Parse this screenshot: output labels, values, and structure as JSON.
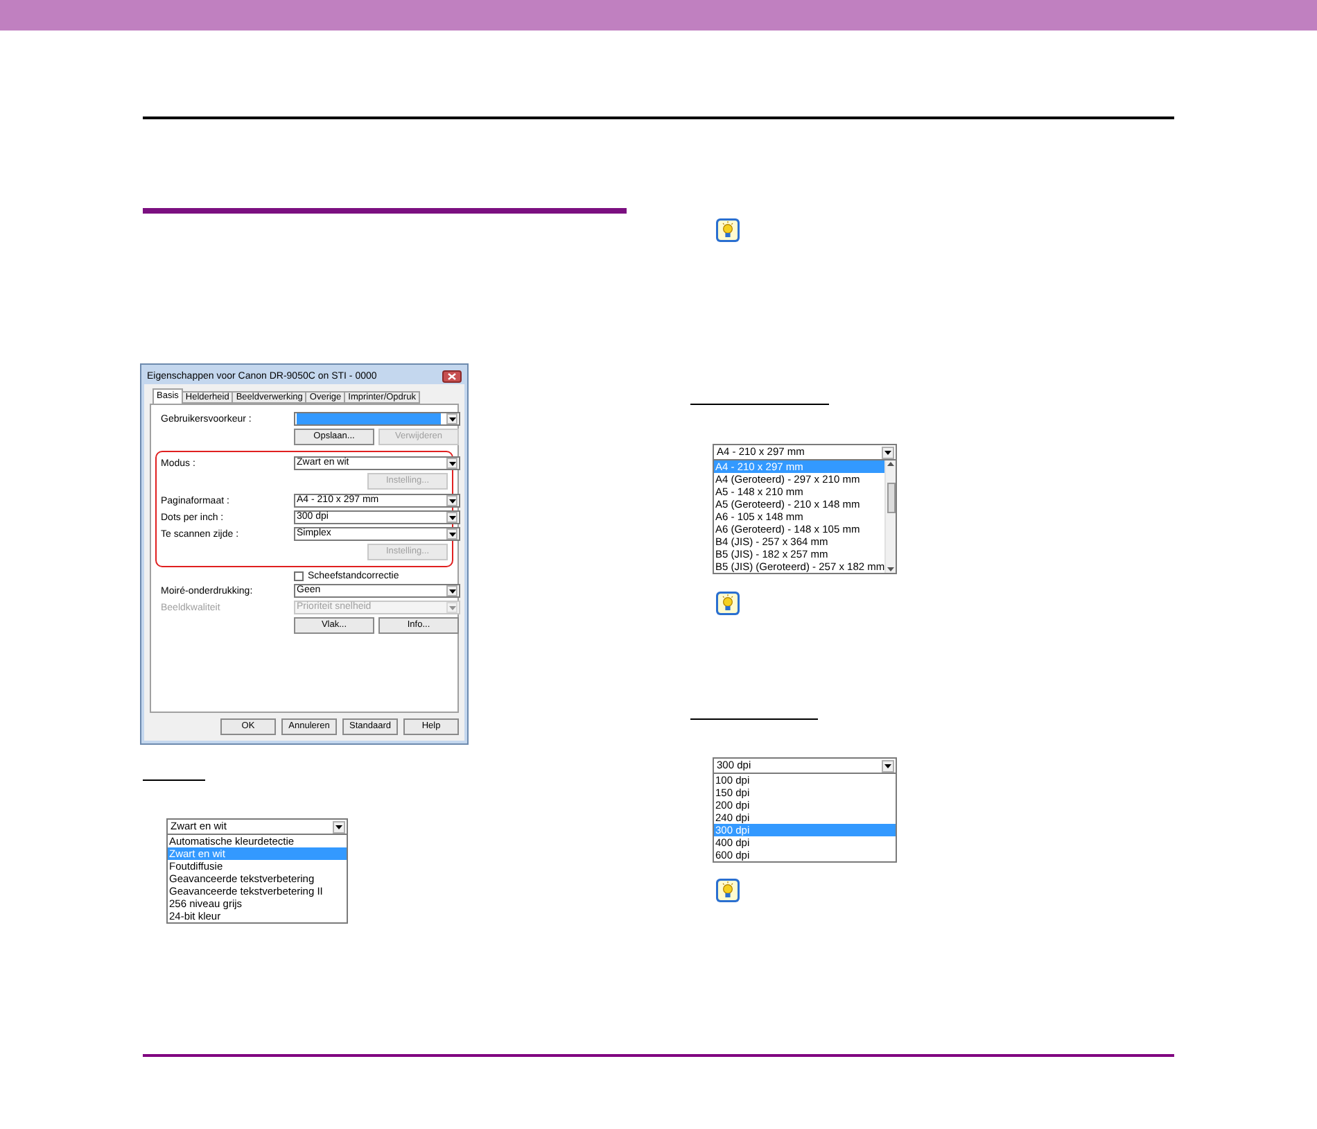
{
  "dialog": {
    "title": "Eigenschappen voor Canon DR-9050C on STI - 0000",
    "tabs": [
      {
        "label": "Basis",
        "selected": true
      },
      {
        "label": "Helderheid",
        "selected": false
      },
      {
        "label": "Beeldverwerking",
        "selected": false
      },
      {
        "label": "Overige",
        "selected": false
      },
      {
        "label": "Imprinter/Opdruk",
        "selected": false
      }
    ],
    "sections": [
      {
        "rows": [
          {
            "kind": "dropdown",
            "label": "Gebruikersvoorkeur :",
            "selected": true,
            "disabled": false
          },
          {
            "kind": "buttons",
            "buttons": [
              {
                "label": "Opslaan...",
                "disabled": false
              },
              {
                "label": "Verwijderen",
                "disabled": true
              }
            ]
          }
        ]
      },
      {
        "highlighted": true,
        "rows": [
          {
            "kind": "dropdown",
            "label": "Modus :",
            "value": "Zwart en wit",
            "disabled": false
          },
          {
            "kind": "buttons",
            "buttons": [
              {
                "label": "Instelling...",
                "disabled": true
              }
            ]
          },
          {
            "kind": "dropdown",
            "label": "Paginaformaat :",
            "value": "A4 - 210 x 297 mm",
            "disabled": false
          },
          {
            "kind": "dropdown",
            "label": "Dots per inch :",
            "value": "300 dpi",
            "disabled": false
          },
          {
            "kind": "dropdown",
            "label": "Te scannen zijde :",
            "value": "Simplex",
            "disabled": false
          },
          {
            "kind": "buttons",
            "buttons": [
              {
                "label": "Instelling...",
                "disabled": true
              }
            ]
          }
        ]
      },
      {
        "rows": [
          {
            "kind": "checkbox",
            "label": "Scheefstandcorrectie",
            "checked": false
          },
          {
            "kind": "dropdown",
            "label": "Moiré-onderdrukking:",
            "value": "Geen",
            "disabled": false
          },
          {
            "kind": "dropdown",
            "label": "Beeldkwaliteit",
            "value": "Prioriteit snelheid",
            "disabled": true
          },
          {
            "kind": "buttons",
            "buttons": [
              {
                "label": "Vlak...",
                "disabled": false
              },
              {
                "label": "Info...",
                "disabled": false
              }
            ]
          }
        ]
      }
    ],
    "footer_buttons": [
      "OK",
      "Annuleren",
      "Standaard",
      "Help"
    ]
  },
  "mode_list": {
    "value": "Zwart en wit",
    "options": [
      {
        "label": "Automatische kleurdetectie",
        "selected": false
      },
      {
        "label": "Zwart en wit",
        "selected": true
      },
      {
        "label": "Foutdiffusie",
        "selected": false
      },
      {
        "label": "Geavanceerde tekstverbetering",
        "selected": false
      },
      {
        "label": "Geavanceerde tekstverbetering II",
        "selected": false
      },
      {
        "label": "256 niveau grijs",
        "selected": false
      },
      {
        "label": "24-bit kleur",
        "selected": false
      }
    ]
  },
  "page_size_list": {
    "value": "A4 - 210 x 297 mm",
    "options": [
      {
        "label": "A4 - 210 x 297 mm",
        "selected": true
      },
      {
        "label": "A4 (Geroteerd) - 297 x 210 mm",
        "selected": false
      },
      {
        "label": "A5 - 148 x 210 mm",
        "selected": false
      },
      {
        "label": "A5 (Geroteerd) - 210 x 148 mm",
        "selected": false
      },
      {
        "label": "A6 - 105 x 148 mm",
        "selected": false
      },
      {
        "label": "A6 (Geroteerd) - 148 x 105 mm",
        "selected": false
      },
      {
        "label": "B4 (JIS) - 257 x 364 mm",
        "selected": false
      },
      {
        "label": "B5 (JIS) - 182 x 257 mm",
        "selected": false
      },
      {
        "label": "B5 (JIS) (Geroteerd) - 257 x 182 mm",
        "selected": false
      }
    ]
  },
  "dpi_list": {
    "value": "300 dpi",
    "options": [
      {
        "label": "100 dpi",
        "selected": false
      },
      {
        "label": "150 dpi",
        "selected": false
      },
      {
        "label": "200 dpi",
        "selected": false
      },
      {
        "label": "240 dpi",
        "selected": false
      },
      {
        "label": "300 dpi",
        "selected": true
      },
      {
        "label": "400 dpi",
        "selected": false
      },
      {
        "label": "600 dpi",
        "selected": false
      }
    ]
  }
}
